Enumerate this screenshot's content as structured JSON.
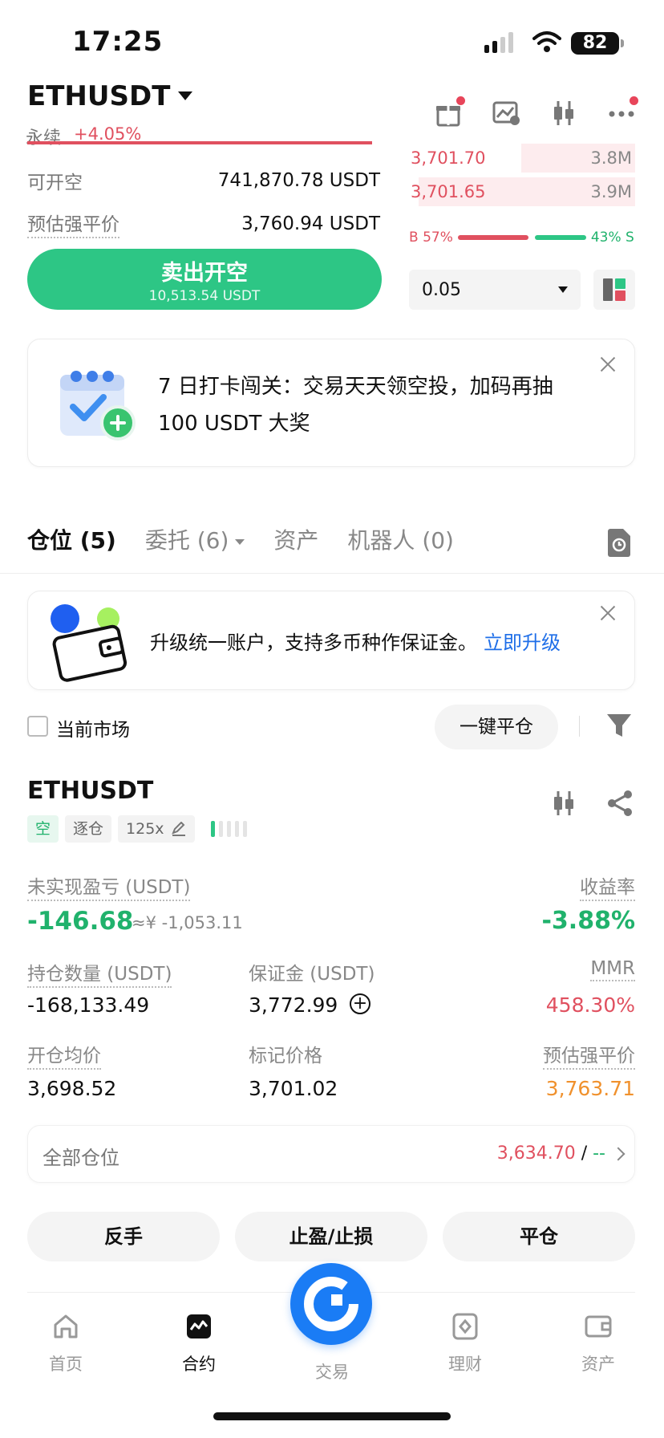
{
  "status_bar": {
    "time": "17:25",
    "battery": "82"
  },
  "header": {
    "pair": "ETHUSDT",
    "contract_type": "永续",
    "change": "+4.05%"
  },
  "order_form": {
    "available_short_label": "可开空",
    "available_short_value": "741,870.78 USDT",
    "est_liq_label": "预估强平价",
    "est_liq_value": "3,760.94 USDT",
    "sell_label": "卖出开空",
    "sell_amount": "10,513.54 USDT"
  },
  "order_book": {
    "asks": [
      {
        "price": "3,701.70",
        "size": "3.8M",
        "depth": 0.5
      },
      {
        "price": "3,701.65",
        "size": "3.9M",
        "depth": 0.95
      }
    ],
    "buy_ratio": "B 57%",
    "sell_ratio": "43% S",
    "quantity": "0.05"
  },
  "promo": {
    "text": "7 日打卡闯关：交易天天领空投，加码再抽 100 USDT 大奖"
  },
  "tabs": {
    "positions": "仓位 (5)",
    "orders": "委托 (6)",
    "assets": "资产",
    "bots": "机器人 (0)"
  },
  "upgrade": {
    "text": "升级统一账户，支持多币种作保证金。",
    "link": "立即升级"
  },
  "filters": {
    "current_market": "当前市场",
    "close_all": "一键平仓"
  },
  "position": {
    "symbol": "ETHUSDT",
    "side_tag": "空",
    "margin_mode": "逐仓",
    "leverage": "125x",
    "unrealized_pnl_label": "未实现盈亏 (USDT)",
    "unrealized_pnl": "-146.68",
    "unrealized_pnl_cny": "≈¥ -1,053.11",
    "roi_label": "收益率",
    "roi": "-3.88%",
    "qty_label": "持仓数量 (USDT)",
    "qty": "-168,133.49",
    "margin_label": "保证金 (USDT)",
    "margin": "3,772.99",
    "mmr_label": "MMR",
    "mmr": "458.30%",
    "entry_label": "开仓均价",
    "entry": "3,698.52",
    "mark_label": "标记价格",
    "mark": "3,701.02",
    "liq_label": "预估强平价",
    "liq": "3,763.71"
  },
  "all_positions": {
    "label": "全部仓位",
    "value_red": "3,634.70",
    "separator": "/",
    "value_green": "--"
  },
  "actions": {
    "reverse": "反手",
    "tpsl": "止盈/止损",
    "close": "平仓"
  },
  "nav": {
    "home": "首页",
    "contract": "合约",
    "trade": "交易",
    "finance": "理财",
    "assets": "资产"
  },
  "colors": {
    "green": "#2dc685",
    "red": "#e0505f",
    "blue": "#1a7cf5",
    "orange": "#f0912d"
  }
}
